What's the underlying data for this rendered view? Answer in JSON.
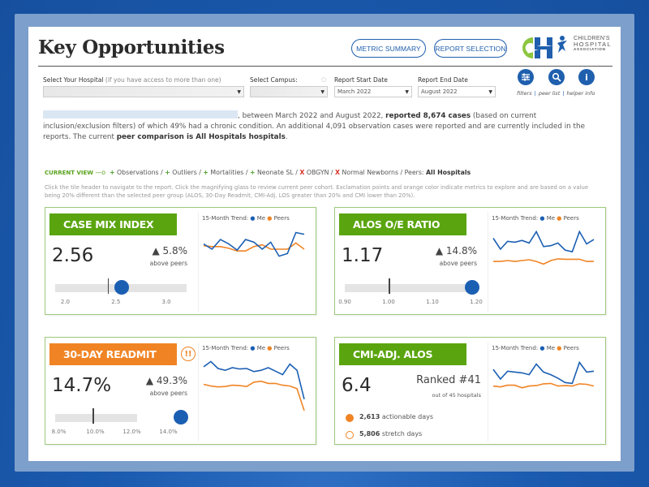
{
  "page": {
    "title": "Key Opportunities",
    "colors": {
      "brand_blue": "#1f5fae",
      "good_green": "#5aa50f",
      "alert_orange": "#f08424",
      "me_series": "#1b5fb3",
      "peers_series": "#f08424"
    }
  },
  "nav": {
    "metric_summary": "METRIC SUMMARY",
    "report_selection": "REPORT SELECTION"
  },
  "logo": {
    "line1": "CHILDREN'S",
    "line2": "HOSPITAL",
    "line3": "ASSOCIATION"
  },
  "filters": {
    "hospital": {
      "label": "Select Your Hospital",
      "hint": "(if you have access to more than one)",
      "value": ""
    },
    "campus": {
      "label": "Select Campus:",
      "value": ""
    },
    "start_date": {
      "label": "Report Start Date",
      "value": "March 2022"
    },
    "end_date": {
      "label": "Report End Date",
      "value": "August 2022"
    }
  },
  "tools": [
    {
      "icon": "filters-icon",
      "caption": "filters"
    },
    {
      "icon": "magnifier-icon",
      "caption": "peer list"
    },
    {
      "icon": "info-icon",
      "caption": "helper info"
    }
  ],
  "summary": {
    "part1": ", between March 2022 and August 2022, ",
    "cases": "reported 8,674 cases",
    "part2": " (based on current inclusion/exclusion filters) of which 49% had a chronic condition. An additional 4,091 observation cases were reported and are currently included in the reports. The current ",
    "peer": "peer comparison is All Hospitals hospitals",
    "part3": "."
  },
  "current_view": {
    "label": "CURRENT VIEW",
    "included": [
      "Observations",
      "Outliers",
      "Mortalities",
      "Neonate SL"
    ],
    "excluded": [
      "OBGYN",
      "Normal Newborns"
    ],
    "peers_label": "Peers:",
    "peers_value": "All Hospitals"
  },
  "help_text": "Click the tile header to navigate to the report. Click the magnifying glass to review current peer cohort. Exclamation points and orange color indicate metrics to explore and are based on a value being 20% different than the selected peer group (ALOS, 30-Day Readmit, CMI-Adj. LOS greater than 20% and CMI lower than 20%).",
  "trend_legend": {
    "label": "15-Month Trend:",
    "me": "Me",
    "peers": "Peers"
  },
  "tiles": {
    "cmi": {
      "title": "CASE MIX INDEX",
      "value": "2.56",
      "delta": "▲ 5.8%",
      "delta_sub": "above peers",
      "gauge": {
        "min": 1.9,
        "max": 3.2,
        "peer": 2.42,
        "me": 2.56,
        "ticks": [
          "2.0",
          "2.5",
          "3.0"
        ]
      },
      "trend": {
        "me": [
          0.62,
          0.5,
          0.72,
          0.62,
          0.48,
          0.72,
          0.66,
          0.5,
          0.66,
          0.34,
          0.4,
          0.88,
          0.84
        ],
        "peers": [
          0.58,
          0.56,
          0.56,
          0.52,
          0.46,
          0.46,
          0.56,
          0.6,
          0.5,
          0.5,
          0.5,
          0.64,
          0.5
        ]
      }
    },
    "alos": {
      "title": "ALOS O/E RATIO",
      "value": "1.17",
      "delta": "▲ 14.8%",
      "delta_sub": "above peers",
      "gauge": {
        "min": 0.9,
        "max": 1.2,
        "peer": 1.0,
        "me": 1.19,
        "ticks": [
          "0.90",
          "1.00",
          "1.10",
          "1.20"
        ]
      },
      "trend": {
        "me": [
          0.75,
          0.5,
          0.68,
          0.66,
          0.7,
          0.64,
          0.9,
          0.56,
          0.58,
          0.64,
          0.48,
          0.44,
          0.9,
          0.62,
          0.72
        ],
        "peers": [
          0.22,
          0.22,
          0.24,
          0.22,
          0.24,
          0.26,
          0.22,
          0.16,
          0.24,
          0.28,
          0.27,
          0.27,
          0.27,
          0.22,
          0.22
        ]
      }
    },
    "readmit": {
      "title": "30-DAY READMIT",
      "alert": "!!",
      "value": "14.7%",
      "delta": "▲ 49.3%",
      "delta_sub": "above peers",
      "gauge": {
        "min": 7.8,
        "max": 15.0,
        "peer": 9.85,
        "me": 14.7,
        "track_max": 12.3,
        "ticks": [
          "8.0%",
          "10.0%",
          "12.0%",
          "14.0%"
        ]
      },
      "trend": {
        "me": [
          0.78,
          0.9,
          0.74,
          0.7,
          0.76,
          0.73,
          0.74,
          0.67,
          0.7,
          0.76,
          0.68,
          0.6,
          0.84,
          0.7,
          0.04
        ],
        "peers": [
          0.38,
          0.34,
          0.32,
          0.33,
          0.36,
          0.35,
          0.33,
          0.43,
          0.45,
          0.4,
          0.4,
          0.36,
          0.34,
          0.28,
          -0.22
        ]
      }
    },
    "cmi_alos": {
      "title": "CMI-ADJ. ALOS",
      "value": "6.4",
      "rank": "Ranked #41",
      "rank_sub": "out of 45 hospitals",
      "actionable": {
        "value": "2,613",
        "label": " actionable days"
      },
      "stretch": {
        "value": "5,806",
        "label": " stretch days"
      },
      "trend": {
        "me": [
          0.72,
          0.5,
          0.68,
          0.66,
          0.64,
          0.6,
          0.84,
          0.66,
          0.6,
          0.52,
          0.42,
          0.4,
          0.88,
          0.66,
          0.68
        ],
        "peers": [
          0.34,
          0.32,
          0.36,
          0.36,
          0.3,
          0.34,
          0.35,
          0.39,
          0.4,
          0.34,
          0.35,
          0.34,
          0.39,
          0.38,
          0.34
        ]
      }
    }
  }
}
